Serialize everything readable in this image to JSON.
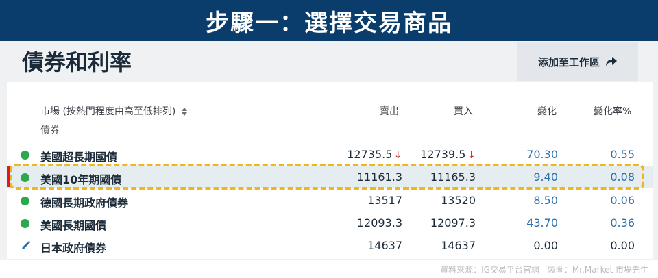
{
  "banner": {
    "title": "步驟一：選擇交易商品"
  },
  "page": {
    "title": "債券和利率"
  },
  "toolbar": {
    "add_workspace_label": "添加至工作區"
  },
  "table": {
    "headers": {
      "market": "市場 (按熱門程度由高至低排列)",
      "sell": "賣出",
      "buy": "買入",
      "change": "變化",
      "change_pct": "變化率%"
    },
    "category": "債券",
    "rows": [
      {
        "name": "美國超長期國債",
        "sell": "12735.5",
        "sell_dir": "↓",
        "buy": "12739.5",
        "buy_dir": "↓",
        "change": "70.30",
        "change_pct": "0.55",
        "status": "green-dot"
      },
      {
        "name": "美國10年期國債",
        "sell": "11161.3",
        "buy": "11165.3",
        "change": "9.40",
        "change_pct": "0.08",
        "status": "green-dot",
        "highlighted": true
      },
      {
        "name": "德國長期政府債券",
        "sell": "13517",
        "buy": "13520",
        "change": "8.50",
        "change_pct": "0.06",
        "status": "green-dot"
      },
      {
        "name": "美國長期國債",
        "sell": "12093.3",
        "buy": "12097.3",
        "change": "43.70",
        "change_pct": "0.36",
        "status": "green-dot"
      },
      {
        "name": "日本政府債券",
        "sell": "14637",
        "buy": "14637",
        "change": "0.00",
        "change_pct": "0.00",
        "status": "pencil-icon"
      }
    ]
  },
  "footer": {
    "note": "資料來源：IG交易平台官網　製圖：Mr.Market 市場先生"
  },
  "colors": {
    "banner_bg": "#0a3d6b",
    "status_green": "#2fa74c",
    "change_blue": "#2a70ad",
    "down_red": "#d32020",
    "highlight_dash": "#f0b51f"
  }
}
